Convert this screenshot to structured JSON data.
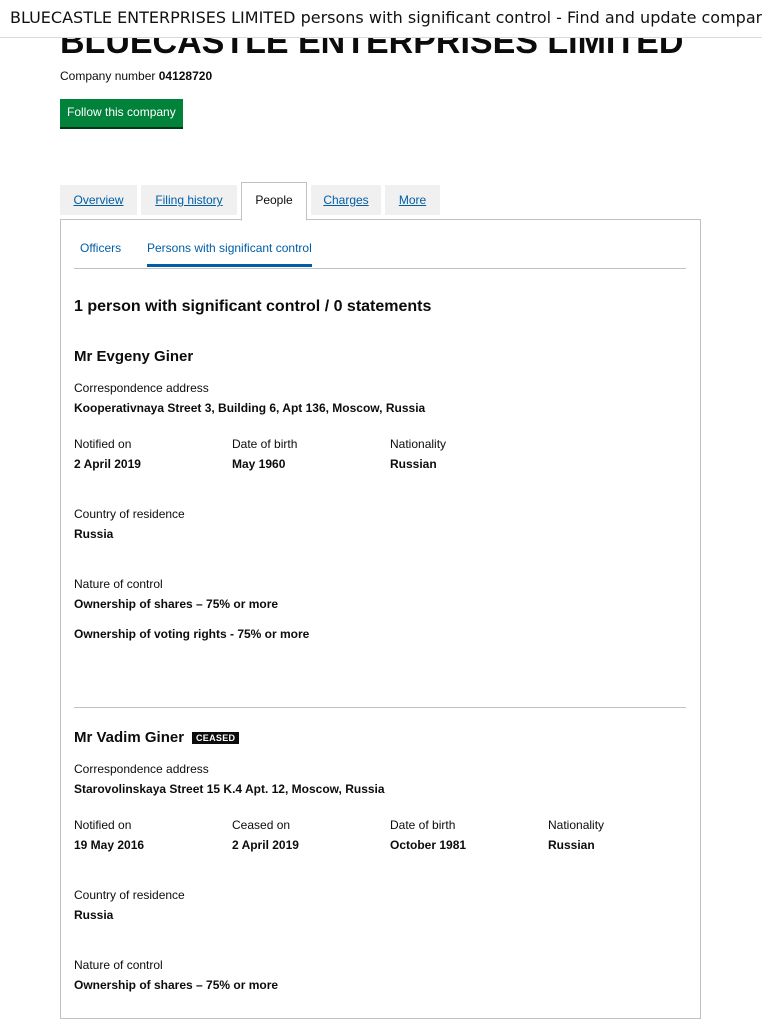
{
  "window": {
    "title": "BLUECASTLE ENTERPRISES LIMITED persons with significant control - Find and update company information - GOV.UK"
  },
  "company": {
    "name": "BLUECASTLE ENTERPRISES LIMITED",
    "number_label": "Company number",
    "number": "04128720",
    "follow_label": "Follow this company"
  },
  "tabs": [
    {
      "label": "Overview",
      "active": false
    },
    {
      "label": "Filing history",
      "active": false
    },
    {
      "label": "People",
      "active": true
    },
    {
      "label": "Charges",
      "active": false
    },
    {
      "label": "More",
      "active": false
    }
  ],
  "subtabs": [
    {
      "label": "Officers",
      "active": false
    },
    {
      "label": "Persons with significant control",
      "active": true
    }
  ],
  "summary": "1 person with significant control / 0 statements",
  "persons": [
    {
      "name": "Mr Evgeny Giner",
      "address_label": "Correspondence address",
      "address": "Kooperativnaya Street 3, Building 6, Apt 136, Moscow, Russia",
      "notified_label": "Notified on",
      "notified": "2 April 2019",
      "dob_label": "Date of birth",
      "dob": "May 1960",
      "nationality_label": "Nationality",
      "nationality": "Russian",
      "residence_label": "Country of residence",
      "residence": "Russia",
      "control_label": "Nature of control",
      "control_1": "Ownership of shares – 75% or more",
      "control_2": "Ownership of voting rights - 75% or more"
    },
    {
      "name": "Mr Vadim Giner",
      "badge": "CEASED",
      "address_label": "Correspondence address",
      "address": "Starovolinskaya Street 15 K.4 Apt. 12, Moscow, Russia",
      "notified_label": "Notified on",
      "notified": "19 May 2016",
      "ceased_label": "Ceased on",
      "ceased": "2 April 2019",
      "dob_label": "Date of birth",
      "dob": "October 1981",
      "nationality_label": "Nationality",
      "nationality": "Russian",
      "residence_label": "Country of residence",
      "residence": "Russia",
      "control_label": "Nature of control",
      "control_1": "Ownership of shares – 75% or more"
    }
  ],
  "colors": {
    "link": "#005ea5",
    "button": "#00823b",
    "text": "#0b0c0c",
    "border": "#bfc1c3"
  }
}
